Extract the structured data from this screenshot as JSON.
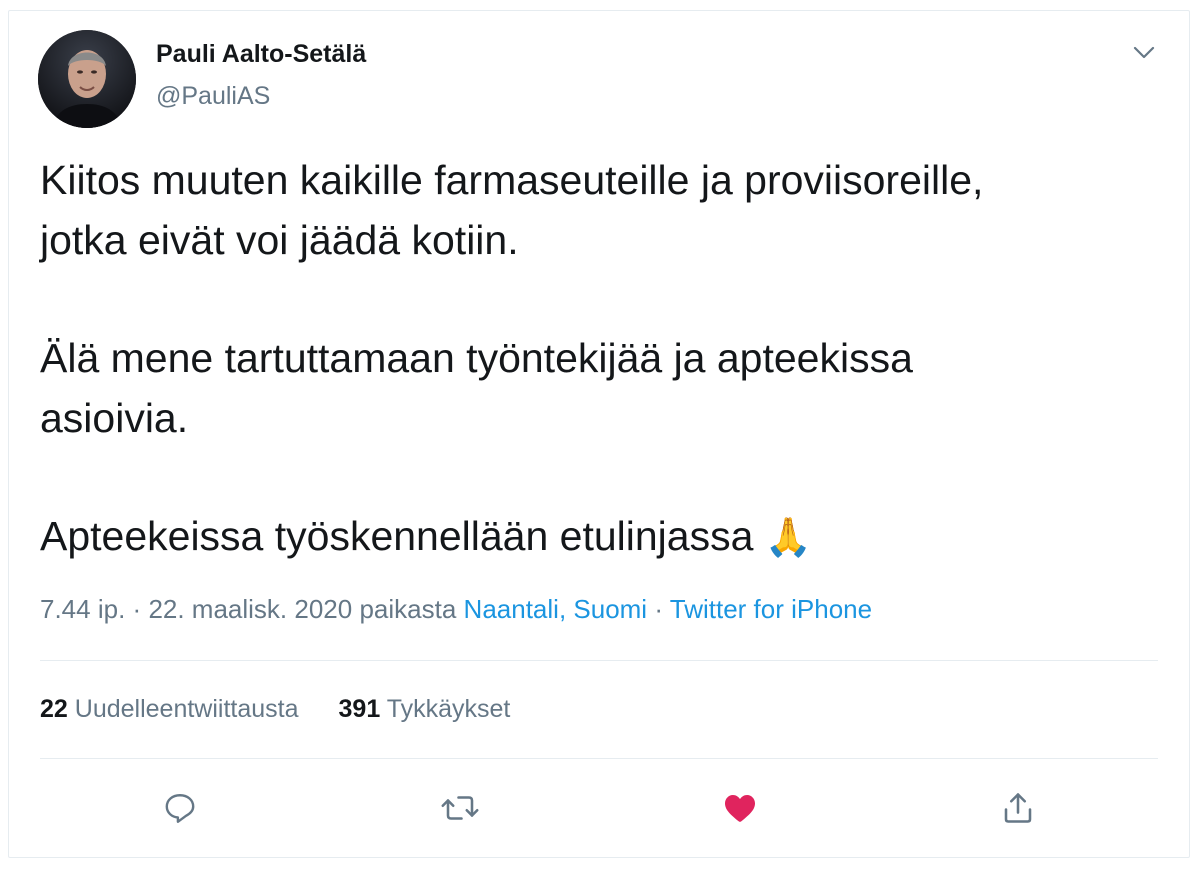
{
  "author": {
    "name": "Pauli Aalto-Setälä",
    "handle": "@PauliAS"
  },
  "tweet": {
    "paragraphs": [
      [
        "Kiitos muuten kaikille farmaseuteille ja proviisoreille,",
        "jotka eivät voi jäädä kotiin."
      ],
      [
        "Älä mene tartuttamaan työntekijää ja apteekissa",
        "asioivia."
      ],
      [
        "Apteekeissa työskennellään etulinjassa"
      ]
    ],
    "emoji": "🙏"
  },
  "meta": {
    "time": "7.44 ip.",
    "date": "22. maalisk. 2020",
    "from_label": "paikasta",
    "location": "Naantali, Suomi",
    "source": "Twitter for iPhone",
    "separator": "·"
  },
  "stats": {
    "retweets_count": "22",
    "retweets_label": "Uudelleentwiittausta",
    "likes_count": "391",
    "likes_label": "Tykkäykset"
  },
  "colors": {
    "text": "#14171a",
    "secondary": "#657786",
    "link": "#1b95e0",
    "like": "#e0245e",
    "border": "#e6ecf0"
  },
  "icons": {
    "reply": "reply-icon",
    "retweet": "retweet-icon",
    "like": "heart-icon",
    "share": "share-icon",
    "menu": "chevron-down-icon"
  }
}
